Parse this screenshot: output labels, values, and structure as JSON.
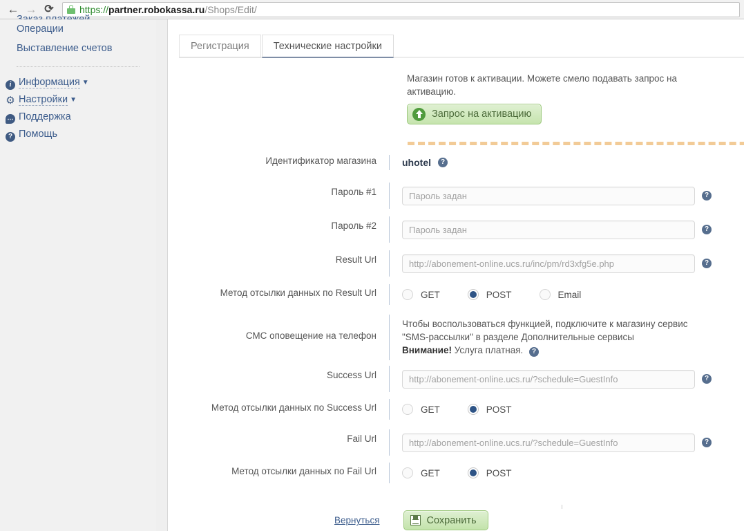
{
  "browser": {
    "back_icon": "back-arrow-icon",
    "forward_icon": "forward-arrow-icon",
    "reload_icon": "reload-icon",
    "lock_icon": "lock-icon",
    "url_scheme": "https://",
    "url_host": "partner.robokassa.ru",
    "url_path": "/Shops/Edit/"
  },
  "sidebar": {
    "top_clipped_item": "Заказ платежей",
    "links": [
      {
        "label": "Операции"
      },
      {
        "label": "Выставление счетов"
      }
    ],
    "menu": [
      {
        "label": "Информация",
        "icon": "info-icon",
        "caret": "▼",
        "dashed": true
      },
      {
        "label": "Настройки",
        "icon": "gear-icon",
        "caret": "▼",
        "dashed": true
      },
      {
        "label": "Поддержка",
        "icon": "support-bubble-icon",
        "caret": "",
        "dashed": false
      },
      {
        "label": "Помощь",
        "icon": "help-question-icon",
        "caret": "",
        "dashed": false
      }
    ]
  },
  "tabs": [
    {
      "label": "Регистрация",
      "active": false
    },
    {
      "label": "Технические настройки",
      "active": true
    }
  ],
  "activation": {
    "notice": "Магазин готов к активации. Можете смело подавать запрос на активацию.",
    "button_label": "Запрос на активацию",
    "button_icon": "upload-arrow-icon"
  },
  "form": {
    "shop_id": {
      "label": "Идентификатор магазина",
      "value": "uhotel",
      "help": "?"
    },
    "password1": {
      "label": "Пароль #1",
      "placeholder": "Пароль задан",
      "value": "",
      "help": "?"
    },
    "password2": {
      "label": "Пароль #2",
      "placeholder": "Пароль задан",
      "value": "",
      "help": "?"
    },
    "result_url": {
      "label": "Result Url",
      "value": "http://abonement-online.ucs.ru/inc/pm/rd3xfg5e.php",
      "help": "?"
    },
    "result_method": {
      "label": "Метод отсылки данных по Result Url",
      "options": [
        {
          "label": "GET",
          "selected": false
        },
        {
          "label": "POST",
          "selected": true
        },
        {
          "label": "Email",
          "selected": false
        }
      ]
    },
    "sms": {
      "label": "СМС оповещение на телефон",
      "line1": "Чтобы воспользоваться функцией, подключите к магазину сервис",
      "line2": "\"SMS-рассылки\" в разделе Дополнительные сервисы",
      "line3_bold": "Внимание!",
      "line3_rest": " Услуга платная.",
      "help": "?"
    },
    "success_url": {
      "label": "Success Url",
      "value": "http://abonement-online.ucs.ru/?schedule=GuestInfo",
      "help": "?"
    },
    "success_method": {
      "label": "Метод отсылки данных по Success Url",
      "options": [
        {
          "label": "GET",
          "selected": false
        },
        {
          "label": "POST",
          "selected": true
        }
      ]
    },
    "fail_url": {
      "label": "Fail Url",
      "value": "http://abonement-online.ucs.ru/?schedule=GuestInfo",
      "help": "?"
    },
    "fail_method": {
      "label": "Метод отсылки данных по Fail Url",
      "options": [
        {
          "label": "GET",
          "selected": false
        },
        {
          "label": "POST",
          "selected": true
        }
      ]
    }
  },
  "footer": {
    "back_label": "Вернуться",
    "save_label": "Сохранить",
    "save_icon": "floppy-disk-icon"
  },
  "colors": {
    "accent_link": "#3c5c8c",
    "radio_selected": "#2e5486",
    "button_green_border": "#9ec97f",
    "dashed_rule": "#f0c285",
    "help_icon": "#566e8e"
  }
}
